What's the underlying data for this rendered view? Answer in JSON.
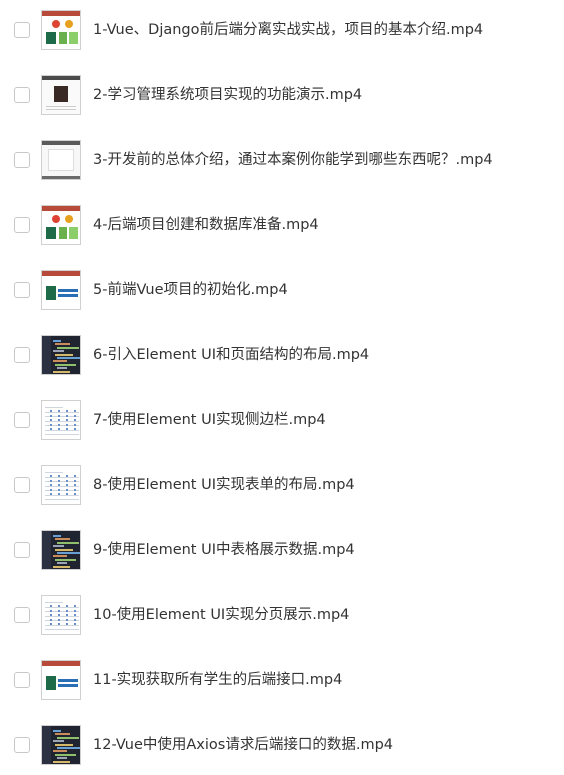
{
  "files": [
    {
      "name": "1-Vue、Django前后端分离实战实战，项目的基本介绍.mp4",
      "thumb": "ppt"
    },
    {
      "name": "2-学习管理系统项目实现的功能演示.mp4",
      "thumb": "browser"
    },
    {
      "name": "3-开发前的总体介绍，通过本案例你能学到哪些东西呢？.mp4",
      "thumb": "form"
    },
    {
      "name": "4-后端项目创建和数据库准备.mp4",
      "thumb": "ppt"
    },
    {
      "name": "5-前端Vue项目的初始化.mp4",
      "thumb": "pptb"
    },
    {
      "name": "6-引入Element UI和页面结构的布局.mp4",
      "thumb": "code"
    },
    {
      "name": "7-使用Element UI实现侧边栏.mp4",
      "thumb": "table"
    },
    {
      "name": "8-使用Element UI实现表单的布局.mp4",
      "thumb": "table"
    },
    {
      "name": "9-使用Element UI中表格展示数据.mp4",
      "thumb": "code"
    },
    {
      "name": "10-使用Element UI实现分页展示.mp4",
      "thumb": "table"
    },
    {
      "name": "11-实现获取所有学生的后端接口.mp4",
      "thumb": "pptb"
    },
    {
      "name": "12-Vue中使用Axios请求后端接口的数据.mp4",
      "thumb": "code"
    }
  ]
}
